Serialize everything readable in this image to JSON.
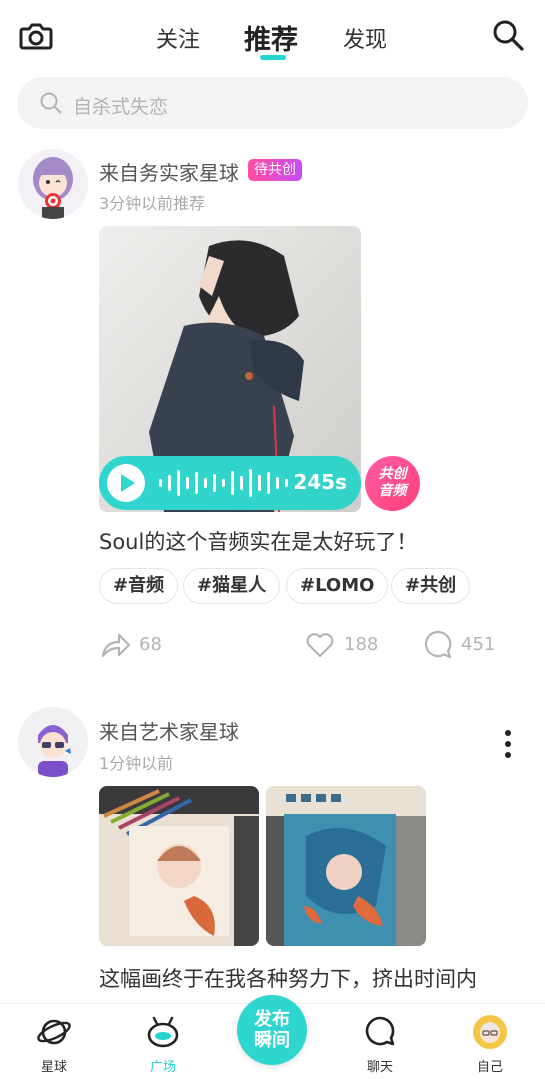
{
  "header": {
    "tabs": [
      "关注",
      "推荐",
      "发现"
    ],
    "active_tab": "推荐"
  },
  "search": {
    "placeholder": "自杀式失恋"
  },
  "posts": [
    {
      "author": "来自务实家星球",
      "badge": "待共创",
      "time": "3分钟以前推荐",
      "audio_duration": "245s",
      "co_create_label": "共创\n音频",
      "co_create_line1": "共创",
      "co_create_line2": "音频",
      "text": "Soul的这个音频实在是太好玩了！",
      "tags": [
        "#音频",
        "#猫星人",
        "#LOMO",
        "#共创"
      ],
      "shares": "68",
      "likes": "188",
      "comments": "451"
    },
    {
      "author": "来自艺术家星球",
      "time": "1分钟以前",
      "text": "这幅画终于在我各种努力下，挤出时间内"
    }
  ],
  "bottom_nav": {
    "items": [
      "星球",
      "广场",
      "聊天",
      "自己"
    ],
    "active": "广场",
    "publish_line1": "发布",
    "publish_line2": "瞬间"
  },
  "colors": {
    "accent": "#25d4d0",
    "badge": "#ff4fa0",
    "co_create": "#ff3f76"
  }
}
